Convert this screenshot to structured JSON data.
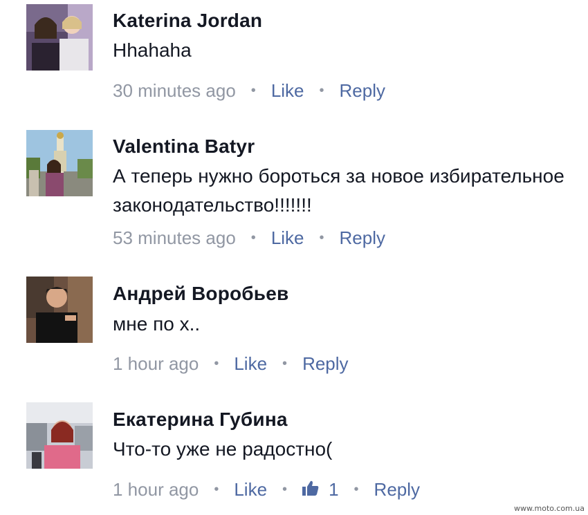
{
  "comments": [
    {
      "author": "Katerina Jordan",
      "text": "Hhahaha",
      "time": "30 minutes ago",
      "like_label": "Like",
      "reply_label": "Reply"
    },
    {
      "author": "Valentina  Batyr",
      "text": "А теперь нужно бороться за новое избирательное законодательство!!!!!!!",
      "time": "53 minutes ago",
      "like_label": "Like",
      "reply_label": "Reply"
    },
    {
      "author": "Андрей Воробьев",
      "text": "мне по х..",
      "time": "1 hour ago",
      "like_label": "Like",
      "reply_label": "Reply"
    },
    {
      "author": "Екатерина Губина",
      "text": "Что-то уже не радостно(",
      "time": "1 hour ago",
      "like_label": "Like",
      "likes_count": "1",
      "reply_label": "Reply"
    }
  ],
  "separator": "•",
  "watermark": "www.moto.com.ua",
  "colors": {
    "author": "#141823",
    "meta": "#9197a3",
    "link": "#4e69a2"
  },
  "icons": {
    "like_count": "thumbs-up-icon"
  }
}
